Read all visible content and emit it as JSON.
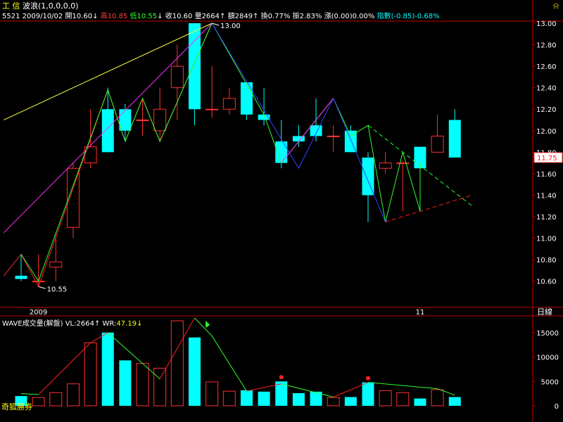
{
  "header": {
    "title": "工 信",
    "indicator": "波浪(1,0,0,0,0)",
    "code": "5521",
    "date": "2009/10/02",
    "open_label": "開",
    "open": "10.60",
    "high_label": "高",
    "high": "10.85",
    "low_label": "低",
    "low": "10.55",
    "close_label": "收",
    "close": "10.60",
    "volume_label": "量",
    "volume": "2664",
    "amount_label": "額",
    "amount": "2849",
    "turnover_label": "換",
    "turnover": "0.77%",
    "amplitude_label": "振",
    "amplitude": "2.83%",
    "change_label": "漲",
    "change": "(0.00)0.00%",
    "index_label": "指數",
    "index_change": "(-0.85)-0.68%",
    "arrow_down": "↓",
    "arrow_up": "↑",
    "bell_icon": "⍾"
  },
  "volume_panel": {
    "title": "WAVE成交量(解盤)",
    "vl_label": "VL:",
    "vl": "2664",
    "wr_label": "WR:",
    "wr": "47.19"
  },
  "brand": "奇狐勝券",
  "colors": {
    "up": "#ff3030",
    "down": "#00ffff",
    "axis": "#c00000",
    "wave_green": "#30ff30",
    "wave_red": "#ff2020",
    "wave_blue": "#3040ff",
    "wave_magenta": "#ff30ff",
    "wave_yellow": "#ffff40",
    "text": "#ffffff"
  },
  "chart_data": {
    "type": "candlestick",
    "price_axis": {
      "ylim": [
        10.5,
        13.0
      ],
      "ticks": [
        "13.00",
        "12.80",
        "12.60",
        "12.40",
        "12.20",
        "12.00",
        "11.80",
        "11.60",
        "11.40",
        "11.20",
        "11.00",
        "10.80",
        "10.60"
      ]
    },
    "x_labels": [
      {
        "index": 1,
        "text": "2009"
      },
      {
        "index": 23,
        "text": "11"
      }
    ],
    "period_label": "日線",
    "current_price": "11.75",
    "annotations": [
      {
        "index": 1,
        "value": 10.55,
        "text": "10.55"
      },
      {
        "index": 11,
        "value": 13.0,
        "text": "13.00"
      }
    ],
    "candles": [
      {
        "o": 10.65,
        "c": 10.62,
        "h": 10.85,
        "l": 10.6
      },
      {
        "o": 10.6,
        "c": 10.6,
        "h": 10.85,
        "l": 10.55
      },
      {
        "o": 10.73,
        "c": 10.78,
        "h": 11.03,
        "l": 10.6
      },
      {
        "o": 11.1,
        "c": 11.65,
        "h": 11.7,
        "l": 11.0
      },
      {
        "o": 11.7,
        "c": 11.85,
        "h": 12.2,
        "l": 11.65
      },
      {
        "o": 12.2,
        "c": 11.8,
        "h": 12.4,
        "l": 11.8
      },
      {
        "o": 12.2,
        "c": 12.0,
        "h": 12.25,
        "l": 11.9
      },
      {
        "o": 12.1,
        "c": 12.1,
        "h": 12.3,
        "l": 11.95
      },
      {
        "o": 12.0,
        "c": 12.2,
        "h": 12.4,
        "l": 11.9
      },
      {
        "o": 12.4,
        "c": 12.6,
        "h": 12.8,
        "l": 12.1
      },
      {
        "o": 13.0,
        "c": 12.2,
        "h": 13.0,
        "l": 12.05
      },
      {
        "o": 12.2,
        "c": 12.2,
        "h": 12.6,
        "l": 12.12
      },
      {
        "o": 12.2,
        "c": 12.3,
        "h": 12.4,
        "l": 12.15
      },
      {
        "o": 12.45,
        "c": 12.15,
        "h": 12.45,
        "l": 12.1
      },
      {
        "o": 12.15,
        "c": 12.1,
        "h": 12.4,
        "l": 12.05
      },
      {
        "o": 11.9,
        "c": 11.7,
        "h": 12.1,
        "l": 11.65
      },
      {
        "o": 11.95,
        "c": 11.9,
        "h": 12.05,
        "l": 11.85
      },
      {
        "o": 12.05,
        "c": 11.95,
        "h": 12.3,
        "l": 11.9
      },
      {
        "o": 11.95,
        "c": 11.95,
        "h": 12.05,
        "l": 11.8
      },
      {
        "o": 12.0,
        "c": 11.8,
        "h": 12.05,
        "l": 11.8
      },
      {
        "o": 11.75,
        "c": 11.4,
        "h": 11.8,
        "l": 11.15
      },
      {
        "o": 11.65,
        "c": 11.7,
        "h": 11.8,
        "l": 11.6
      },
      {
        "o": 11.7,
        "c": 11.7,
        "h": 11.72,
        "l": 11.25
      },
      {
        "o": 11.85,
        "c": 11.65,
        "h": 11.85,
        "l": 11.65
      },
      {
        "o": 11.8,
        "c": 11.95,
        "h": 12.15,
        "l": 11.8
      },
      {
        "o": 12.1,
        "c": 11.75,
        "h": 12.2,
        "l": 11.75
      }
    ],
    "volume_axis": {
      "ylim": [
        0,
        18000
      ],
      "ticks": [
        "15000",
        "10000",
        "5000",
        "0"
      ]
    },
    "volumes": [
      2000,
      1700,
      2700,
      4500,
      12900,
      15000,
      9300,
      8700,
      7700,
      17400,
      14000,
      4900,
      3000,
      3200,
      2900,
      5000,
      2600,
      2900,
      1700,
      1800,
      4800,
      3100,
      2700,
      1500,
      3300,
      1800
    ],
    "volume_peak_dots": [
      15,
      20
    ],
    "volume_zigzag": [
      [
        0,
        2500
      ],
      [
        1,
        2300
      ],
      [
        4,
        12900
      ],
      [
        5,
        15000
      ],
      [
        8,
        5500
      ],
      [
        10,
        18000
      ],
      [
        11,
        14300
      ],
      [
        13,
        3000
      ],
      [
        15,
        4500
      ],
      [
        18,
        1800
      ],
      [
        20,
        4800
      ],
      [
        24,
        3500
      ],
      [
        25,
        2200
      ]
    ],
    "wave_lines": [
      {
        "color": "wave_yellow",
        "points": [
          [
            -1,
            12.1
          ],
          [
            11,
            13.0
          ]
        ]
      },
      {
        "color": "wave_magenta",
        "points": [
          [
            -1,
            11.05
          ],
          [
            11,
            13.0
          ]
        ]
      },
      {
        "color": "wave_red",
        "points": [
          [
            -1,
            10.65
          ],
          [
            0,
            10.85
          ],
          [
            1,
            10.55
          ],
          [
            5,
            12.38
          ],
          [
            6,
            11.9
          ],
          [
            7,
            12.3
          ],
          [
            8,
            11.9
          ],
          [
            11,
            13.0
          ]
        ]
      },
      {
        "color": "wave_green",
        "points": [
          [
            0,
            10.85
          ],
          [
            1,
            10.6
          ],
          [
            5,
            12.38
          ],
          [
            6,
            11.9
          ],
          [
            7,
            12.3
          ],
          [
            8,
            11.9
          ],
          [
            11,
            13.0
          ],
          [
            14,
            12.15
          ],
          [
            15,
            11.7
          ],
          [
            18,
            12.3
          ],
          [
            19,
            11.95
          ],
          [
            20,
            12.05
          ],
          [
            21,
            11.15
          ],
          [
            22,
            11.8
          ],
          [
            23,
            11.25
          ],
          [
            23,
            11.7
          ]
        ]
      },
      {
        "color": "wave_blue",
        "points": [
          [
            11,
            13.0
          ],
          [
            16,
            11.65
          ],
          [
            18,
            12.3
          ],
          [
            21,
            11.15
          ]
        ]
      },
      {
        "color": "wave_magenta",
        "points": [
          [
            15,
            11.7
          ],
          [
            18,
            12.3
          ]
        ]
      }
    ],
    "triangle_lines": [
      {
        "color": "wave_green",
        "points": [
          [
            20,
            12.05
          ],
          [
            26,
            11.3
          ]
        ]
      },
      {
        "color": "wave_red",
        "points": [
          [
            21,
            11.15
          ],
          [
            26,
            11.4
          ]
        ]
      }
    ]
  }
}
